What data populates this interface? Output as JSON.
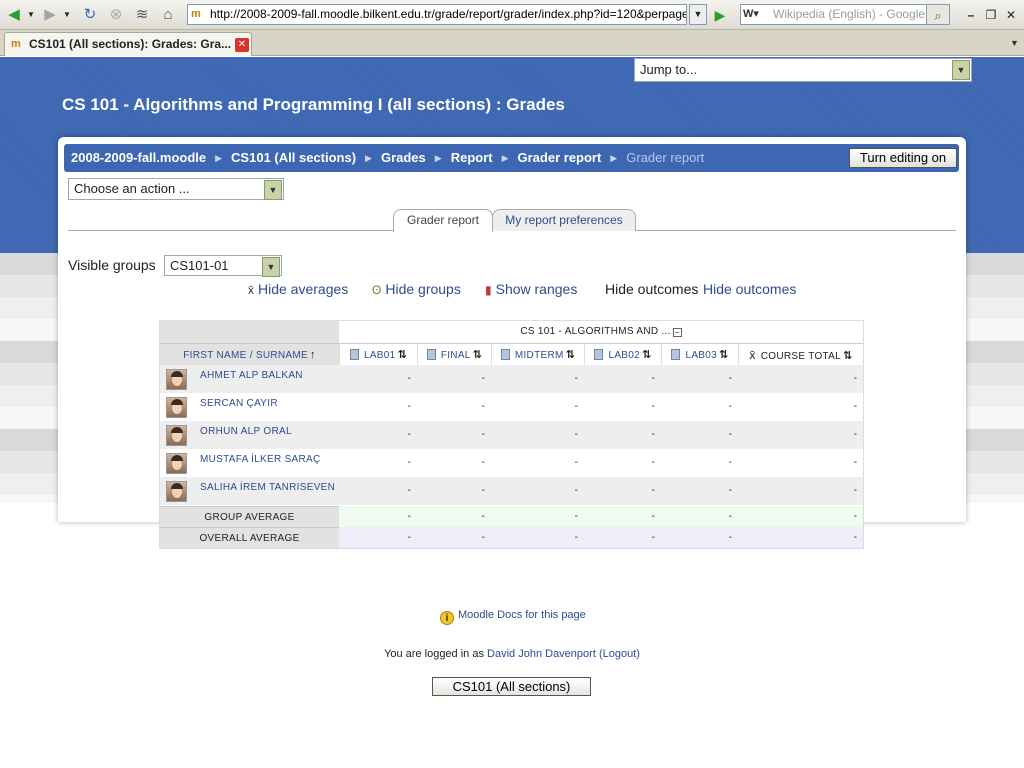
{
  "browser": {
    "url": "http://2008-2009-fall.moodle.bilkent.edu.tr/grade/report/grader/index.php?id=120&perpage=10",
    "search_placeholder": "Wikipedia (English) - Google",
    "tab_title": "CS101 (All sections): Grades: Gra...",
    "favicon_text": "m"
  },
  "page": {
    "jump_to": "Jump to...",
    "course_title": "CS 101 - Algorithms and Programming I (all sections) : Grades",
    "breadcrumbs": [
      "2008-2009-fall.moodle",
      "CS101 (All sections)",
      "Grades",
      "Report",
      "Grader report"
    ],
    "breadcrumb_current": "Grader report",
    "editing_button": "Turn editing on",
    "action_select": "Choose an action ...",
    "tabs": [
      "Grader report",
      "My report preferences"
    ],
    "visible_groups_label": "Visible groups",
    "visible_groups_value": "CS101-01",
    "toggles": {
      "hide_averages": "Hide averages",
      "hide_groups": "Hide groups",
      "show_ranges": "Show ranges",
      "hide_outcomes_plain": "Hide outcomes",
      "hide_outcomes_link": "Hide outcomes"
    }
  },
  "grader": {
    "course_header": "CS 101 - ALGORITHMS AND ...",
    "collapse_symbol": "−",
    "name_header": "FIRST NAME / SURNAME",
    "columns": [
      "LAB01",
      "FINAL",
      "MIDTERM",
      "LAB02",
      "LAB03",
      "COURSE TOTAL"
    ],
    "students": [
      {
        "name": "AHMET ALP BALKAN",
        "grades": [
          "-",
          "-",
          "-",
          "-",
          "-",
          "-"
        ]
      },
      {
        "name": "SERCAN ÇAYIR",
        "grades": [
          "-",
          "-",
          "-",
          "-",
          "-",
          "-"
        ]
      },
      {
        "name": "ORHUN ALP ORAL",
        "grades": [
          "-",
          "-",
          "-",
          "-",
          "-",
          "-"
        ]
      },
      {
        "name": "MUSTAFA İLKER SARAÇ",
        "grades": [
          "-",
          "-",
          "-",
          "-",
          "-",
          "-"
        ]
      },
      {
        "name": "SALIHA İREM TANRISEVEN",
        "grades": [
          "-",
          "-",
          "-",
          "-",
          "-",
          "-"
        ]
      }
    ],
    "group_average_label": "GROUP AVERAGE",
    "group_average": [
      "-",
      "-",
      "-",
      "-",
      "-",
      "-"
    ],
    "overall_average_label": "OVERALL AVERAGE",
    "overall_average": [
      "-",
      "-",
      "-",
      "-",
      "-",
      "-"
    ]
  },
  "footer": {
    "docs_link": "Moodle Docs for this page",
    "logged_in_prefix": "You are logged in as",
    "user_name": "David John Davenport",
    "logout": "(Logout)",
    "course_button": "CS101 (All sections)"
  },
  "colors": {
    "banner": "#3d67b2",
    "link": "#2a4e8d"
  }
}
